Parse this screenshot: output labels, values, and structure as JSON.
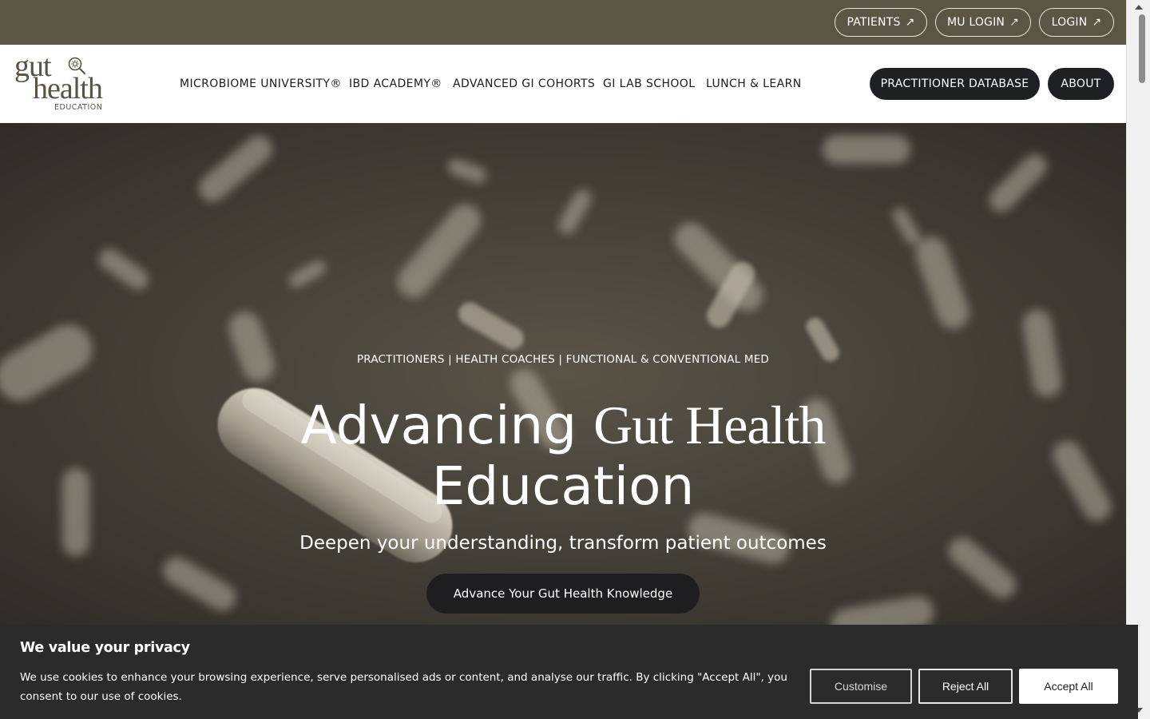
{
  "topbar": {
    "patients": "PATIENTS",
    "mu_login": "MU LOGIN",
    "login": "LOGIN",
    "external_icon": "↗"
  },
  "logo": {
    "line1": "gut",
    "line2": "health",
    "line3": "EDUCATION"
  },
  "nav": {
    "items": [
      "MICROBIOME UNIVERSITY®",
      "IBD ACADEMY®",
      "ADVANCED GI COHORTS",
      "GI LAB SCHOOL",
      "LUNCH & LEARN"
    ],
    "practitioner_database": "PRACTITIONER DATABASE",
    "about": "ABOUT"
  },
  "hero": {
    "eyebrow": "PRACTITIONERS | HEALTH COACHES | FUNCTIONAL & CONVENTIONAL MED",
    "headline_part1": "Advancing",
    "headline_part2": "Gut Health",
    "headline_part3": "Education",
    "subhead": "Deepen your understanding, transform patient outcomes",
    "cta": "Advance Your Gut Health Knowledge"
  },
  "cookie": {
    "title": "We value your privacy",
    "text": "We use cookies to enhance your browsing experience, serve personalised ads or content, and analyse our traffic. By clicking \"Accept All\", you consent to our use of cookies.",
    "customise": "Customise",
    "reject": "Reject All",
    "accept": "Accept All"
  },
  "colors": {
    "topbar": "#5b5546",
    "dark_button": "#1f2023",
    "logo": "#5a5344",
    "cookie_bg": "#2b2b2b"
  }
}
